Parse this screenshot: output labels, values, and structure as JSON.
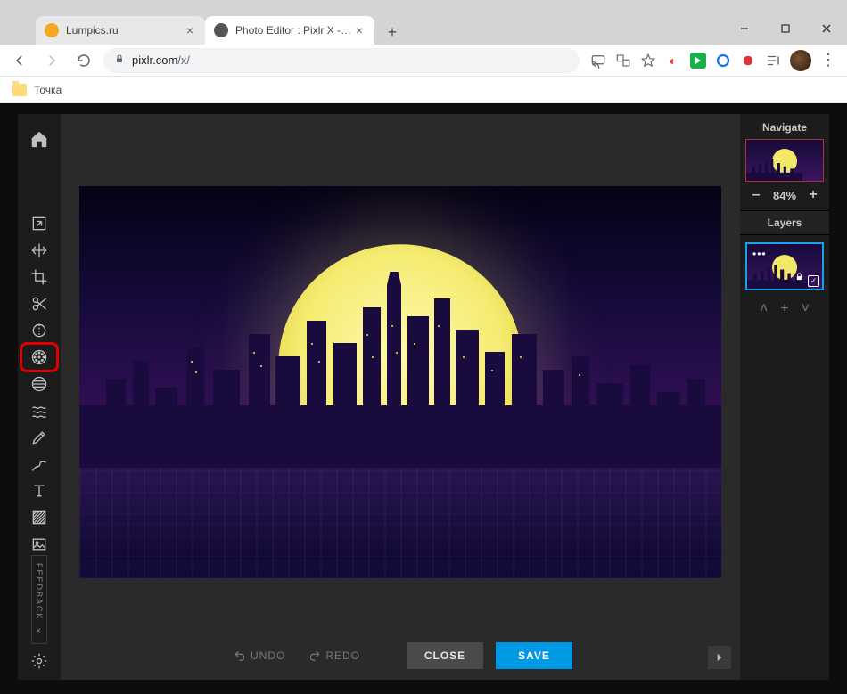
{
  "browser": {
    "tabs": [
      {
        "title": "Lumpics.ru",
        "icon_color": "#f5a623",
        "active": false
      },
      {
        "title": "Photo Editor : Pixlr X - free image editing",
        "icon_color": "#555",
        "active": true
      }
    ],
    "url_host": "pixlr.com",
    "url_path": "/x/",
    "bookmark_label": "Точка"
  },
  "toolbar": {
    "items": [
      {
        "name": "home-icon"
      },
      {
        "name": "resize-icon"
      },
      {
        "name": "arrange-icon"
      },
      {
        "name": "crop-icon"
      },
      {
        "name": "cutout-icon"
      },
      {
        "name": "adjust-icon"
      },
      {
        "name": "filter-icon",
        "highlighted": true
      },
      {
        "name": "effect-icon"
      },
      {
        "name": "liquify-icon"
      },
      {
        "name": "retouch-icon"
      },
      {
        "name": "draw-icon"
      },
      {
        "name": "text-icon"
      },
      {
        "name": "element-icon"
      },
      {
        "name": "image-icon"
      }
    ],
    "feedback_label": "FEEDBACK"
  },
  "footer": {
    "undo_label": "UNDO",
    "redo_label": "REDO",
    "close_label": "CLOSE",
    "save_label": "SAVE"
  },
  "right": {
    "navigate_label": "Navigate",
    "zoom_value": "84%",
    "layers_label": "Layers"
  }
}
